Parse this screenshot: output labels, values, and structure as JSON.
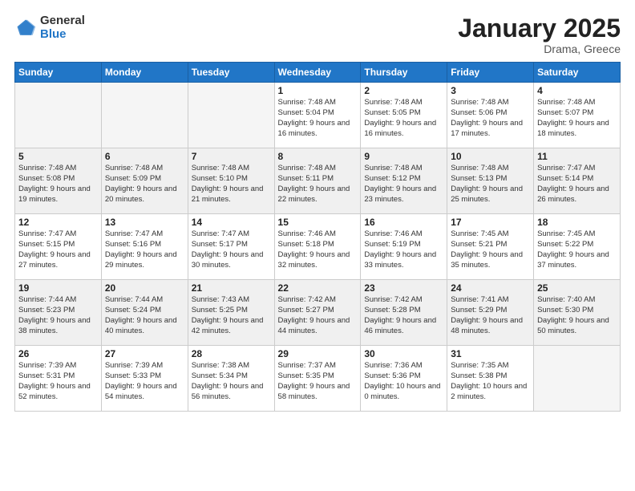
{
  "header": {
    "logo_general": "General",
    "logo_blue": "Blue",
    "month": "January 2025",
    "location": "Drama, Greece"
  },
  "weekdays": [
    "Sunday",
    "Monday",
    "Tuesday",
    "Wednesday",
    "Thursday",
    "Friday",
    "Saturday"
  ],
  "weeks": [
    [
      {
        "day": "",
        "empty": true
      },
      {
        "day": "",
        "empty": true
      },
      {
        "day": "",
        "empty": true
      },
      {
        "day": "1",
        "sunrise": "7:48 AM",
        "sunset": "5:04 PM",
        "daylight": "9 hours and 16 minutes."
      },
      {
        "day": "2",
        "sunrise": "7:48 AM",
        "sunset": "5:05 PM",
        "daylight": "9 hours and 16 minutes."
      },
      {
        "day": "3",
        "sunrise": "7:48 AM",
        "sunset": "5:06 PM",
        "daylight": "9 hours and 17 minutes."
      },
      {
        "day": "4",
        "sunrise": "7:48 AM",
        "sunset": "5:07 PM",
        "daylight": "9 hours and 18 minutes."
      }
    ],
    [
      {
        "day": "5",
        "sunrise": "7:48 AM",
        "sunset": "5:08 PM",
        "daylight": "9 hours and 19 minutes."
      },
      {
        "day": "6",
        "sunrise": "7:48 AM",
        "sunset": "5:09 PM",
        "daylight": "9 hours and 20 minutes."
      },
      {
        "day": "7",
        "sunrise": "7:48 AM",
        "sunset": "5:10 PM",
        "daylight": "9 hours and 21 minutes."
      },
      {
        "day": "8",
        "sunrise": "7:48 AM",
        "sunset": "5:11 PM",
        "daylight": "9 hours and 22 minutes."
      },
      {
        "day": "9",
        "sunrise": "7:48 AM",
        "sunset": "5:12 PM",
        "daylight": "9 hours and 23 minutes."
      },
      {
        "day": "10",
        "sunrise": "7:48 AM",
        "sunset": "5:13 PM",
        "daylight": "9 hours and 25 minutes."
      },
      {
        "day": "11",
        "sunrise": "7:47 AM",
        "sunset": "5:14 PM",
        "daylight": "9 hours and 26 minutes."
      }
    ],
    [
      {
        "day": "12",
        "sunrise": "7:47 AM",
        "sunset": "5:15 PM",
        "daylight": "9 hours and 27 minutes."
      },
      {
        "day": "13",
        "sunrise": "7:47 AM",
        "sunset": "5:16 PM",
        "daylight": "9 hours and 29 minutes."
      },
      {
        "day": "14",
        "sunrise": "7:47 AM",
        "sunset": "5:17 PM",
        "daylight": "9 hours and 30 minutes."
      },
      {
        "day": "15",
        "sunrise": "7:46 AM",
        "sunset": "5:18 PM",
        "daylight": "9 hours and 32 minutes."
      },
      {
        "day": "16",
        "sunrise": "7:46 AM",
        "sunset": "5:19 PM",
        "daylight": "9 hours and 33 minutes."
      },
      {
        "day": "17",
        "sunrise": "7:45 AM",
        "sunset": "5:21 PM",
        "daylight": "9 hours and 35 minutes."
      },
      {
        "day": "18",
        "sunrise": "7:45 AM",
        "sunset": "5:22 PM",
        "daylight": "9 hours and 37 minutes."
      }
    ],
    [
      {
        "day": "19",
        "sunrise": "7:44 AM",
        "sunset": "5:23 PM",
        "daylight": "9 hours and 38 minutes."
      },
      {
        "day": "20",
        "sunrise": "7:44 AM",
        "sunset": "5:24 PM",
        "daylight": "9 hours and 40 minutes."
      },
      {
        "day": "21",
        "sunrise": "7:43 AM",
        "sunset": "5:25 PM",
        "daylight": "9 hours and 42 minutes."
      },
      {
        "day": "22",
        "sunrise": "7:42 AM",
        "sunset": "5:27 PM",
        "daylight": "9 hours and 44 minutes."
      },
      {
        "day": "23",
        "sunrise": "7:42 AM",
        "sunset": "5:28 PM",
        "daylight": "9 hours and 46 minutes."
      },
      {
        "day": "24",
        "sunrise": "7:41 AM",
        "sunset": "5:29 PM",
        "daylight": "9 hours and 48 minutes."
      },
      {
        "day": "25",
        "sunrise": "7:40 AM",
        "sunset": "5:30 PM",
        "daylight": "9 hours and 50 minutes."
      }
    ],
    [
      {
        "day": "26",
        "sunrise": "7:39 AM",
        "sunset": "5:31 PM",
        "daylight": "9 hours and 52 minutes."
      },
      {
        "day": "27",
        "sunrise": "7:39 AM",
        "sunset": "5:33 PM",
        "daylight": "9 hours and 54 minutes."
      },
      {
        "day": "28",
        "sunrise": "7:38 AM",
        "sunset": "5:34 PM",
        "daylight": "9 hours and 56 minutes."
      },
      {
        "day": "29",
        "sunrise": "7:37 AM",
        "sunset": "5:35 PM",
        "daylight": "9 hours and 58 minutes."
      },
      {
        "day": "30",
        "sunrise": "7:36 AM",
        "sunset": "5:36 PM",
        "daylight": "10 hours and 0 minutes."
      },
      {
        "day": "31",
        "sunrise": "7:35 AM",
        "sunset": "5:38 PM",
        "daylight": "10 hours and 2 minutes."
      },
      {
        "day": "",
        "empty": true
      }
    ]
  ],
  "labels": {
    "sunrise_label": "Sunrise: ",
    "sunset_label": "Sunset: ",
    "daylight_label": "Daylight: "
  }
}
